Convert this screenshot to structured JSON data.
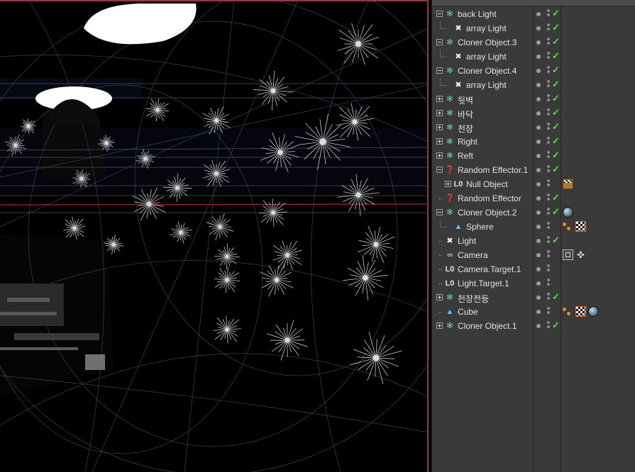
{
  "objects": [
    {
      "label": "back Light",
      "icon": "cloner-icon",
      "depth": 0,
      "expander": "open",
      "tags": []
    },
    {
      "label": "array Light",
      "icon": "light-icon",
      "depth": 1,
      "expander": "none",
      "tags": []
    },
    {
      "label": "Cloner Object.3",
      "icon": "cloner-icon",
      "depth": 0,
      "expander": "open",
      "tags": []
    },
    {
      "label": "array Light",
      "icon": "light-icon",
      "depth": 1,
      "expander": "none",
      "tags": []
    },
    {
      "label": "Cloner Object.4",
      "icon": "cloner-icon",
      "depth": 0,
      "expander": "open",
      "tags": []
    },
    {
      "label": "array Light",
      "icon": "light-icon",
      "depth": 1,
      "expander": "none",
      "tags": []
    },
    {
      "label": "뒷벽",
      "icon": "cloner-icon",
      "depth": 0,
      "expander": "closed",
      "tags": []
    },
    {
      "label": "바닥",
      "icon": "cloner-icon",
      "depth": 0,
      "expander": "closed",
      "tags": []
    },
    {
      "label": "천장",
      "icon": "cloner-icon",
      "depth": 0,
      "expander": "closed",
      "tags": []
    },
    {
      "label": "Right",
      "icon": "cloner-icon",
      "depth": 0,
      "expander": "closed",
      "tags": []
    },
    {
      "label": "Reft",
      "icon": "cloner-icon",
      "depth": 0,
      "expander": "closed",
      "tags": []
    },
    {
      "label": "Random Effector.1",
      "icon": "effector-icon",
      "depth": 0,
      "expander": "open",
      "tags": []
    },
    {
      "label": "Null Object",
      "icon": "null-icon",
      "depth": 1,
      "expander": "closed",
      "tags": [
        "clapboard-tag"
      ]
    },
    {
      "label": "Random Effector",
      "icon": "effector-icon",
      "depth": 0,
      "expander": "none",
      "tags": []
    },
    {
      "label": "Cloner Object.2",
      "icon": "cloner-icon",
      "depth": 0,
      "expander": "open",
      "tags": [
        "sphere-material-tag"
      ]
    },
    {
      "label": "Sphere",
      "icon": "primitive-icon",
      "depth": 1,
      "expander": "none",
      "tags": [
        "phong-tag",
        "checker-material-tag"
      ]
    },
    {
      "label": "Light",
      "icon": "light-icon",
      "depth": 0,
      "expander": "none",
      "tags": []
    },
    {
      "label": "Camera",
      "icon": "camera-icon",
      "depth": 0,
      "expander": "none",
      "tags": [
        "protection-tag",
        "target-tag"
      ]
    },
    {
      "label": "Camera.Target.1",
      "icon": "null-icon",
      "depth": 0,
      "expander": "none",
      "tags": []
    },
    {
      "label": "Light.Target.1",
      "icon": "null-icon",
      "depth": 0,
      "expander": "none",
      "tags": []
    },
    {
      "label": "천장전등",
      "icon": "cloner-icon",
      "depth": 0,
      "expander": "closed",
      "tags": []
    },
    {
      "label": "Cube",
      "icon": "primitive-icon",
      "depth": 0,
      "expander": "none",
      "tags": [
        "phong-tag",
        "checker-material-tag",
        "sphere-material-tag"
      ]
    },
    {
      "label": "Cloner Object.1",
      "icon": "cloner-icon",
      "depth": 0,
      "expander": "closed",
      "tags": []
    }
  ],
  "checked": [
    true,
    true,
    true,
    true,
    true,
    true,
    true,
    true,
    true,
    true,
    true,
    true,
    false,
    true,
    true,
    false,
    true,
    false,
    false,
    false,
    true,
    false,
    true
  ],
  "icons": {
    "cloner-icon": "✻",
    "light-icon": "✖",
    "effector-icon": "❓",
    "null-icon": "L0",
    "camera-icon": "∞",
    "primitive-icon": "▲"
  },
  "colors": {
    "panel_bg": "#3a3a3a",
    "viewport_bg": "#000000",
    "check_green": "#5ddc4e",
    "cloner_teal": "#6fd3c0",
    "viewport_border": "#8c3a44"
  }
}
